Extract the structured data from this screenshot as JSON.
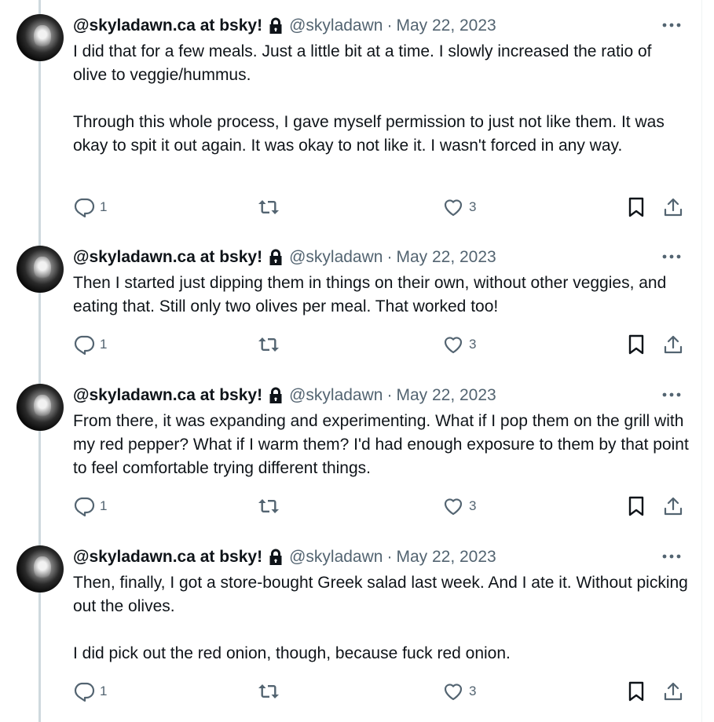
{
  "tweets": [
    {
      "display_name": "@skyladawn.ca at bsky!",
      "handle": "@skyladawn",
      "separator": "·",
      "date": "May 22, 2023",
      "paragraphs": [
        "I did that for a few meals. Just a little bit at a time. I slowly increased the ratio of olive to veggie/hummus.",
        "Through this whole process, I gave myself permission to just not like them. It was okay to spit it out again. It was okay to not like it. I wasn't forced in any way."
      ],
      "reply_count": "1",
      "like_count": "3"
    },
    {
      "display_name": "@skyladawn.ca at bsky!",
      "handle": "@skyladawn",
      "separator": "·",
      "date": "May 22, 2023",
      "paragraphs": [
        "Then I started just dipping them in things on their own, without other veggies, and eating that. Still only two olives per meal. That worked too!"
      ],
      "reply_count": "1",
      "like_count": "3"
    },
    {
      "display_name": "@skyladawn.ca at bsky!",
      "handle": "@skyladawn",
      "separator": "·",
      "date": "May 22, 2023",
      "paragraphs": [
        "From there, it was expanding and experimenting. What if I pop them on the grill with my red pepper? What if I warm them? I'd had enough exposure to them by that point to feel comfortable trying different things."
      ],
      "reply_count": "1",
      "like_count": "3"
    },
    {
      "display_name": "@skyladawn.ca at bsky!",
      "handle": "@skyladawn",
      "separator": "·",
      "date": "May 22, 2023",
      "paragraphs": [
        "Then, finally, I got a store-bought Greek salad last week. And I ate it. Without picking out the olives.",
        "I did pick out the red onion, though, because fuck red onion."
      ],
      "reply_count": "1",
      "like_count": "3"
    }
  ],
  "icons": {
    "avatar": "avatar",
    "protected": "lock-icon",
    "more": "more-icon",
    "reply": "reply-icon",
    "retweet": "retweet-icon",
    "like": "like-icon",
    "bookmark": "bookmark-icon",
    "share": "share-icon"
  },
  "colors": {
    "text": "#0f1419",
    "secondary": "#536471",
    "thread_line": "#cfd9de"
  }
}
